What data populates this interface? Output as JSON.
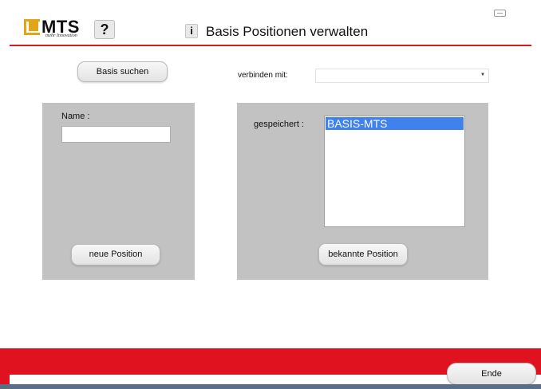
{
  "header": {
    "logo_text": "MTS",
    "logo_subtitle": "mehr Innovation",
    "help_label": "?",
    "info_label": "i",
    "title": "Basis Positionen verwalten",
    "icons": {
      "keyboard": "keyboard-icon",
      "info": "info-icon"
    }
  },
  "toolbar": {
    "basis_suchen_label": "Basis suchen",
    "verbinden_label": "verbinden mit:",
    "verbinden_value": ""
  },
  "left_panel": {
    "name_label": "Name :",
    "name_value": "",
    "neue_position_label": "neue Position"
  },
  "right_panel": {
    "gespeichert_label": "gespeichert :",
    "items": [
      "BASIS-MTS"
    ],
    "selected_index": 0,
    "bekannte_position_label": "bekannte Position"
  },
  "footer": {
    "ende_label": "Ende"
  },
  "colors": {
    "accent_red": "#e0121f",
    "panel_gray": "#c2c2c2",
    "selection_blue": "#3f82ee",
    "logo_gold": "#e2a51a"
  }
}
